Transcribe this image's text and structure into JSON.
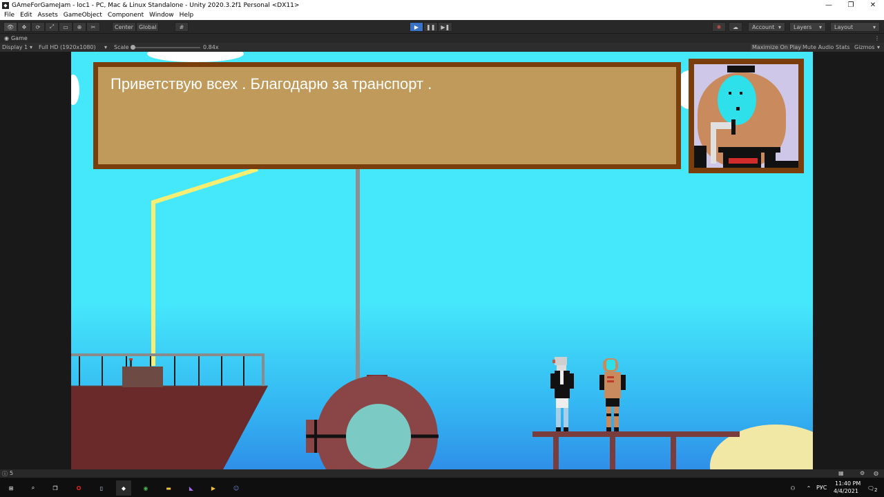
{
  "window": {
    "title": "GAmeForGameJam - loc1 - PC, Mac & Linux Standalone - Unity 2020.3.2f1 Personal <DX11>",
    "controls": [
      "—",
      "❐",
      "✕"
    ]
  },
  "menu": [
    "File",
    "Edit",
    "Assets",
    "GameObject",
    "Component",
    "Window",
    "Help"
  ],
  "toolbar": {
    "pivot": "Center",
    "space": "Global",
    "account": "Account",
    "layers": "Layers",
    "layout": "Layout"
  },
  "game_tab": {
    "label": "Game"
  },
  "game_bar": {
    "display": "Display 1",
    "resolution": "Full HD (1920x1080)",
    "scale_label": "Scale",
    "scale_value": "0.84x",
    "scale_level": 0.0,
    "maximize": "Maximize On Play",
    "mute": "Mute Audio",
    "stats": "Stats",
    "gizmos": "Gizmos"
  },
  "dialog": {
    "text": "Приветствую всех . Благодарю за транспорт ."
  },
  "status": {
    "count": "5"
  },
  "taskbar": {
    "lang": "РУС",
    "time": "11:40 PM",
    "date": "4/4/2021",
    "notif_count": "2"
  },
  "colors": {
    "sky": "#45e8fb",
    "dialog_fill": "#c09a5a",
    "dialog_border": "#7a3d0c",
    "ship": "#6b2a2a",
    "bathysphere": "#8a4646",
    "porthole": "#7ccac4",
    "pier": "#7a3d3d",
    "sand": "#f2e8a6"
  }
}
